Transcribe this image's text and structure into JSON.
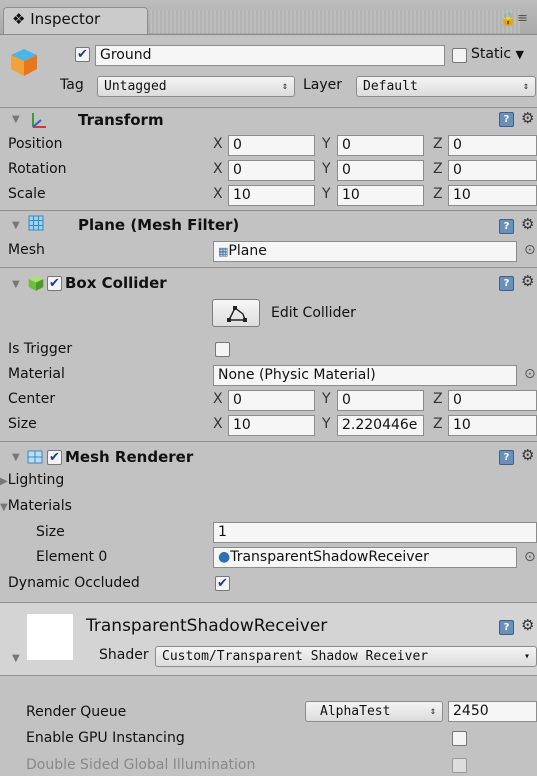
{
  "window": {
    "tab_title": "Inspector",
    "tab_icon": "info-icon",
    "menu_icons": [
      "lock-icon",
      "menu-icon"
    ]
  },
  "object": {
    "name": "Ground",
    "active": true,
    "static_label": "Static",
    "tag_label": "Tag",
    "tag_value": "Untagged",
    "layer_label": "Layer",
    "layer_value": "Default"
  },
  "transform": {
    "title": "Transform",
    "rows": [
      {
        "label": "Position",
        "x": "0",
        "y": "0",
        "z": "0"
      },
      {
        "label": "Rotation",
        "x": "0",
        "y": "0",
        "z": "0"
      },
      {
        "label": "Scale",
        "x": "10",
        "y": "10",
        "z": "10"
      }
    ]
  },
  "axes": {
    "x": "X",
    "y": "Y",
    "z": "Z"
  },
  "mesh_filter": {
    "title": "Plane (Mesh Filter)",
    "mesh_label": "Mesh",
    "mesh_value": "Plane"
  },
  "box_collider": {
    "title": "Box Collider",
    "enabled": true,
    "edit_button": "Edit Collider",
    "is_trigger_label": "Is Trigger",
    "is_trigger": false,
    "material_label": "Material",
    "material_value": "None (Physic Material)",
    "center_label": "Center",
    "center": {
      "x": "0",
      "y": "0",
      "z": "0"
    },
    "size_label": "Size",
    "size": {
      "x": "10",
      "y": "2.220446e",
      "z": "10"
    }
  },
  "mesh_renderer": {
    "title": "Mesh Renderer",
    "enabled": true,
    "lighting_label": "Lighting",
    "materials_label": "Materials",
    "size_label": "Size",
    "size_value": "1",
    "element0_label": "Element 0",
    "element0_value": "TransparentShadowReceiver",
    "dynamic_occluded_label": "Dynamic Occluded",
    "dynamic_occluded": true
  },
  "material": {
    "name": "TransparentShadowReceiver",
    "shader_label": "Shader",
    "shader_value": "Custom/Transparent Shadow Receiver",
    "render_queue_label": "Render Queue",
    "render_queue_mode": "AlphaTest",
    "render_queue_value": "2450",
    "gpu_instancing_label": "Enable GPU Instancing",
    "gpu_instancing": false,
    "double_sided_gi_label": "Double Sided Global Illumination",
    "double_sided_gi": false
  },
  "colors": {
    "background": "#c2c2c2",
    "field": "#f6f6f6",
    "checkmark": "#1d3d8f",
    "help_icon": "#6a8fb8"
  }
}
